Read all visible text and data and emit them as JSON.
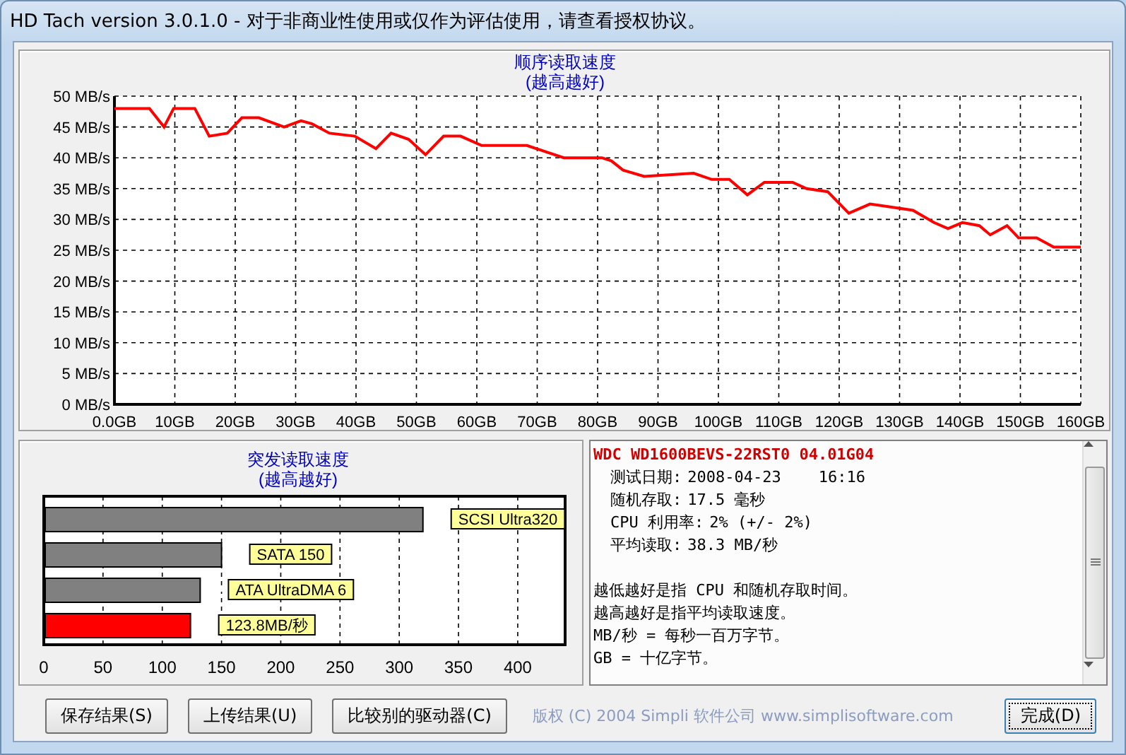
{
  "window": {
    "title": "HD Tach version 3.0.1.0  - 对于非商业性使用或仅作为评估使用，请查看授权协议。"
  },
  "sequential_read": {
    "subtitle": "(越高越好)",
    "chart_data": {
      "type": "line",
      "title": "顺序读取速度",
      "x": [
        0,
        5.8,
        8.2,
        9.8,
        13.3,
        15.7,
        18.7,
        21.1,
        23.9,
        28.1,
        30.9,
        32.7,
        35.6,
        39.8,
        43.3,
        45.8,
        48.7,
        51.5,
        54.5,
        57.3,
        60.8,
        65.5,
        68.3,
        71.3,
        74.4,
        80.7,
        82.3,
        84.2,
        87.7,
        95.9,
        98.9,
        101.8,
        104.8,
        107.6,
        112.3,
        114.6,
        118.1,
        121.6,
        125.1,
        128.7,
        132.2,
        135.7,
        138,
        140.4,
        143.2,
        145,
        147.8,
        149.7,
        152.7,
        155.5,
        160
      ],
      "series": [
        {
          "color": "#ff0000",
          "values": [
            48,
            48,
            45,
            48,
            48,
            43.5,
            44,
            46.5,
            46.5,
            45,
            46,
            45.5,
            44,
            43.5,
            41.5,
            44,
            43,
            40.5,
            43.5,
            43.5,
            42,
            42,
            42,
            41,
            40,
            40,
            39.5,
            38,
            37,
            37.5,
            36.5,
            36.5,
            34,
            36,
            36,
            35,
            34.5,
            31,
            32.5,
            32,
            31.5,
            29.5,
            28.5,
            29.5,
            29,
            27.5,
            29,
            27,
            27,
            25.5,
            25.5
          ]
        }
      ],
      "xlim": [
        0,
        160
      ],
      "ylim": [
        0,
        50
      ],
      "grid": true,
      "xticks": [
        {
          "value": 0,
          "label": "0.0GB"
        },
        {
          "value": 10,
          "label": "10GB"
        },
        {
          "value": 20,
          "label": "20GB"
        },
        {
          "value": 30,
          "label": "30GB"
        },
        {
          "value": 40,
          "label": "40GB"
        },
        {
          "value": 50,
          "label": "50GB"
        },
        {
          "value": 60,
          "label": "60GB"
        },
        {
          "value": 70,
          "label": "70GB"
        },
        {
          "value": 80,
          "label": "80GB"
        },
        {
          "value": 90,
          "label": "90GB"
        },
        {
          "value": 100,
          "label": "100GB"
        },
        {
          "value": 110,
          "label": "110GB"
        },
        {
          "value": 120,
          "label": "120GB"
        },
        {
          "value": 130,
          "label": "130GB"
        },
        {
          "value": 140,
          "label": "140GB"
        },
        {
          "value": 150,
          "label": "150GB"
        },
        {
          "value": 160,
          "label": "160GB"
        }
      ],
      "yticks": [
        {
          "value": 0,
          "label": "0 MB/s"
        },
        {
          "value": 5,
          "label": "5 MB/s"
        },
        {
          "value": 10,
          "label": "10 MB/s"
        },
        {
          "value": 15,
          "label": "15 MB/s"
        },
        {
          "value": 20,
          "label": "20 MB/s"
        },
        {
          "value": 25,
          "label": "25 MB/s"
        },
        {
          "value": 30,
          "label": "30 MB/s"
        },
        {
          "value": 35,
          "label": "35 MB/s"
        },
        {
          "value": 40,
          "label": "40 MB/s"
        },
        {
          "value": 45,
          "label": "45 MB/s"
        },
        {
          "value": 50,
          "label": "50 MB/s"
        }
      ]
    }
  },
  "burst_read": {
    "subtitle": "(越高越好)",
    "chart_data": {
      "type": "bar",
      "orientation": "horizontal",
      "title": "突发读取速度",
      "categories": [
        "SCSI Ultra320",
        "SATA 150",
        "ATA UltraDMA 6",
        "123.8MB/秒"
      ],
      "series": [
        {
          "color": "#808080",
          "values": [
            320,
            150,
            132,
            null
          ]
        },
        {
          "color": "#ff0000",
          "values": [
            null,
            null,
            null,
            123.8
          ]
        }
      ],
      "xlim": [
        0,
        440
      ],
      "xticks": [
        0,
        50,
        100,
        150,
        200,
        250,
        300,
        350,
        400
      ],
      "grid": true
    }
  },
  "info": {
    "drive": "WDC WD1600BEVS-22RST0 04.01G04",
    "stats": [
      {
        "label": "测试日期:",
        "value": "2008-04-23    16:16"
      },
      {
        "label": "随机存取:",
        "value": "17.5 毫秒"
      },
      {
        "label": "CPU 利用率:",
        "value": "2% (+/- 2%)"
      },
      {
        "label": "平均读取:",
        "value": "38.3 MB/秒"
      }
    ],
    "notes": [
      "越低越好是指 CPU 和随机存取时间。",
      "越高越好是指平均读取速度。",
      "MB/秒 = 每秒一百万字节。",
      "GB = 十亿字节。"
    ]
  },
  "buttons": [
    {
      "label": "保存结果(S)"
    },
    {
      "label": "上传结果(U)"
    },
    {
      "label": "比较别的驱动器(C)"
    }
  ],
  "copyright": "版权 (C) 2004 Simpli 软件公司 www.simplisoftware.com",
  "done_button": {
    "label": "完成(D)",
    "focused": true
  }
}
